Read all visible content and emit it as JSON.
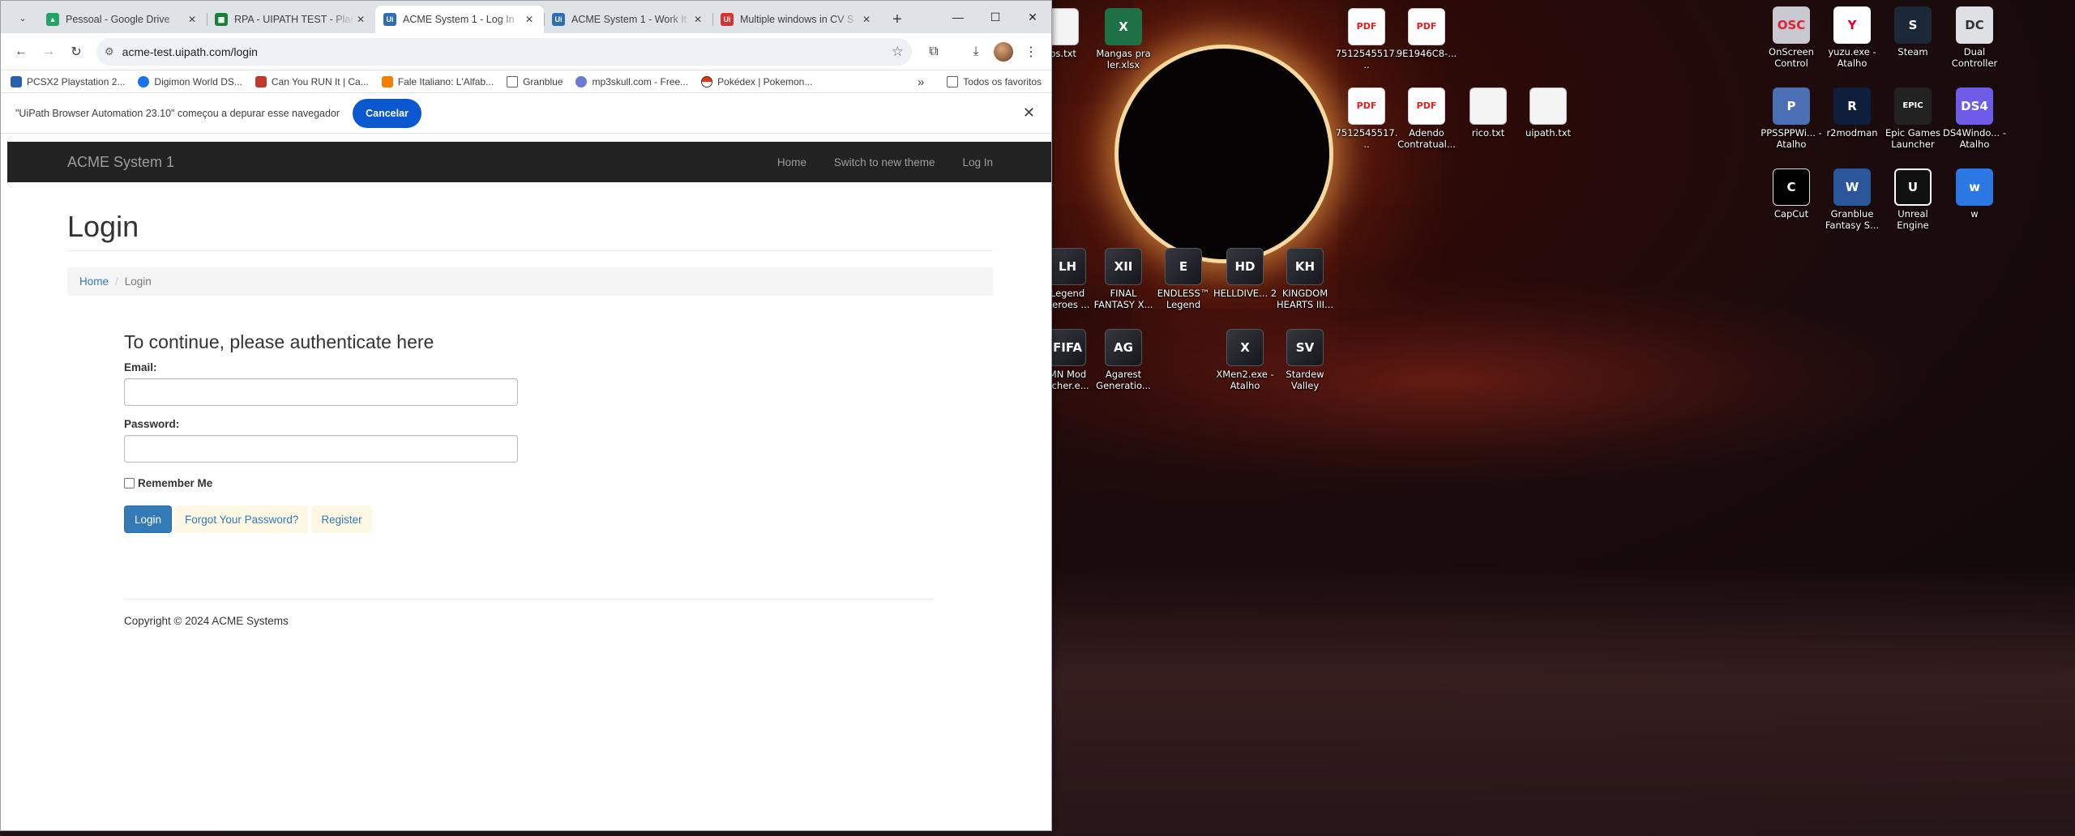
{
  "browser": {
    "tabs": [
      {
        "title": "Pessoal - Google Drive",
        "icon": "google-drive-icon",
        "color": "#1fa463"
      },
      {
        "title": "RPA - UIPATH TEST - Plan",
        "icon": "google-sheets-icon",
        "color": "#188038"
      },
      {
        "title": "ACME System 1 - Log In",
        "icon": "uipath-icon",
        "color": "#2f6db5"
      },
      {
        "title": "ACME System 1 - Work It",
        "icon": "uipath-icon",
        "color": "#2f6db5"
      },
      {
        "title": "Multiple windows in CV S",
        "icon": "uipath-forum-icon",
        "color": "#d6322f"
      }
    ],
    "url": "acme-test.uipath.com/login",
    "bookmarks": [
      "PCSX2 Playstation 2...",
      "Digimon World DS...",
      "Can You RUN It | Ca...",
      "Fale Italiano: L'Alfab...",
      "Granblue",
      "mp3skull.com - Free...",
      "Pokédex | Pokemon..."
    ],
    "bookmarks_more": "»",
    "all_bookmarks": "Todos os favoritos",
    "infobar_text": "\"UiPath Browser Automation 23.10\" começou a depurar esse navegador",
    "infobar_cancel": "Cancelar"
  },
  "site": {
    "brand": "ACME System 1",
    "nav": [
      "Home",
      "Switch to new theme",
      "Log In"
    ],
    "page_title": "Login",
    "breadcrumb_home": "Home",
    "breadcrumb_sep": "/",
    "breadcrumb_current": "Login",
    "auth_heading": "To continue, please authenticate here",
    "email_label": "Email:",
    "email_value": "",
    "password_label": "Password:",
    "password_value": "",
    "remember_label": "Remember Me",
    "login_button": "Login",
    "forgot_button": "Forgot Your Password?",
    "register_button": "Register",
    "footer": "Copyright © 2024 ACME Systems"
  },
  "desktop": {
    "icons": [
      {
        "label": "abs.txt",
        "glyph": "",
        "type": "txt"
      },
      {
        "label": "Mangas pra ler.xlsx",
        "glyph": "X",
        "type": "xls"
      },
      {
        "label": "7512545517...",
        "glyph": "PDF",
        "type": "pdf"
      },
      {
        "label": "9E1946C8-...",
        "glyph": "PDF",
        "type": "pdf"
      },
      {
        "label": "7512545517...",
        "glyph": "PDF",
        "type": "pdf"
      },
      {
        "label": "Adendo Contratual...",
        "glyph": "PDF",
        "type": "pdf"
      },
      {
        "label": "rico.txt",
        "glyph": "",
        "type": "txt"
      },
      {
        "label": "uipath.txt",
        "glyph": "",
        "type": "txt"
      },
      {
        "label": "OnScreen Control",
        "glyph": "OSC",
        "type": "osc"
      },
      {
        "label": "yuzu.exe - Atalho",
        "glyph": "Y",
        "type": "yuzu"
      },
      {
        "label": "Steam",
        "glyph": "S",
        "type": "steam"
      },
      {
        "label": "Dual Controller",
        "glyph": "DC",
        "type": "dual"
      },
      {
        "label": "PPSSPPWi... - Atalho",
        "glyph": "P",
        "type": "ppsspp"
      },
      {
        "label": "r2modman",
        "glyph": "R",
        "type": "r2"
      },
      {
        "label": "Epic Games Launcher",
        "glyph": "EPIC",
        "type": "epic"
      },
      {
        "label": "DS4Windo... - Atalho",
        "glyph": "DS4",
        "type": "ds4"
      },
      {
        "label": "CapCut",
        "glyph": "C",
        "type": "cap"
      },
      {
        "label": "Granblue Fantasy S...",
        "glyph": "W",
        "type": "doc"
      },
      {
        "label": "Unreal Engine",
        "glyph": "U",
        "type": "ue"
      },
      {
        "label": "w",
        "glyph": "w",
        "type": "w"
      },
      {
        "label": "Legend Heroes ...",
        "glyph": "LH",
        "type": "game"
      },
      {
        "label": "FINAL FANTASY X...",
        "glyph": "XII",
        "type": "game"
      },
      {
        "label": "ENDLESS™ Legend",
        "glyph": "E",
        "type": "game"
      },
      {
        "label": "HELLDIVE... 2",
        "glyph": "HD",
        "type": "game"
      },
      {
        "label": "KINGDOM HEARTS III...",
        "glyph": "KH",
        "type": "game"
      },
      {
        "label": "MN Mod ncher.e...",
        "glyph": "FIFA",
        "type": "game"
      },
      {
        "label": "Agarest Generatio...",
        "glyph": "AG",
        "type": "game"
      },
      {
        "label": "XMen2.exe - Atalho",
        "glyph": "X",
        "type": "game"
      },
      {
        "label": "Stardew Valley",
        "glyph": "SV",
        "type": "game"
      }
    ]
  }
}
